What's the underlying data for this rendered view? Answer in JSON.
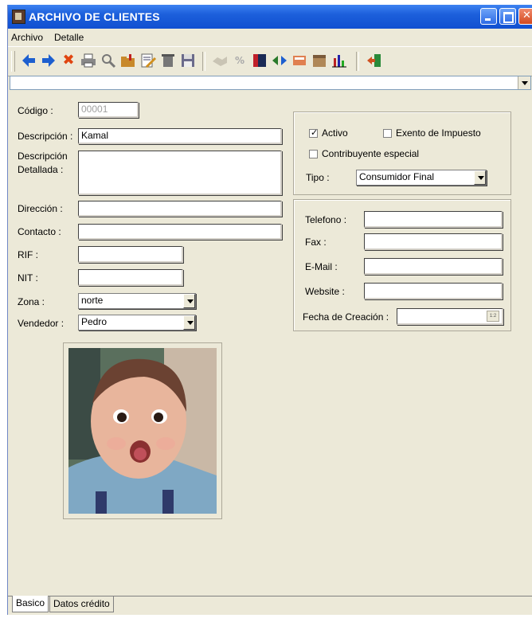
{
  "window": {
    "title": "ARCHIVO DE CLIENTES"
  },
  "menu": [
    "Archivo",
    "Detalle"
  ],
  "toolbar": {
    "icons": [
      "back-arrow-icon",
      "forward-arrow-icon",
      "delete-icon",
      "print-icon",
      "search-icon",
      "folder-add-icon",
      "edit-icon",
      "trash-icon",
      "save-icon",
      "handshake-icon",
      "percent-icon",
      "report-icon",
      "transfer-icon",
      "note-icon",
      "box-icon",
      "bar-chart-icon",
      "exit-icon"
    ]
  },
  "form": {
    "codigo": {
      "label": "Código :",
      "value": "00001"
    },
    "descripcion": {
      "label": "Descripción :",
      "value": "Kamal"
    },
    "descripcion_detallada": {
      "label1": "Descripción",
      "label2": "Detallada :",
      "value": ""
    },
    "direccion": {
      "label": "Dirección :",
      "value": ""
    },
    "contacto": {
      "label": "Contacto :",
      "value": ""
    },
    "rif": {
      "label": "RIF :",
      "value": ""
    },
    "nit": {
      "label": "NIT :",
      "value": ""
    },
    "zona": {
      "label": "Zona :",
      "value": "norte"
    },
    "vendedor": {
      "label": "Vendedor :",
      "value": "Pedro"
    }
  },
  "status_group": {
    "activo": {
      "label": "Activo",
      "checked": true
    },
    "exento": {
      "label": "Exento de Impuesto",
      "checked": false
    },
    "contribuyente": {
      "label": "Contribuyente especial",
      "checked": false
    },
    "tipo": {
      "label": "Tipo :",
      "value": "Consumidor Final"
    }
  },
  "contact_group": {
    "telefono": {
      "label": "Telefono :",
      "value": ""
    },
    "fax": {
      "label": "Fax :",
      "value": ""
    },
    "email": {
      "label": "E-Mail :",
      "value": ""
    },
    "website": {
      "label": "Website :",
      "value": ""
    },
    "fecha": {
      "label": "Fecha de Creación :",
      "value": ""
    }
  },
  "tabs": [
    "Basico",
    "Datos crédito"
  ]
}
